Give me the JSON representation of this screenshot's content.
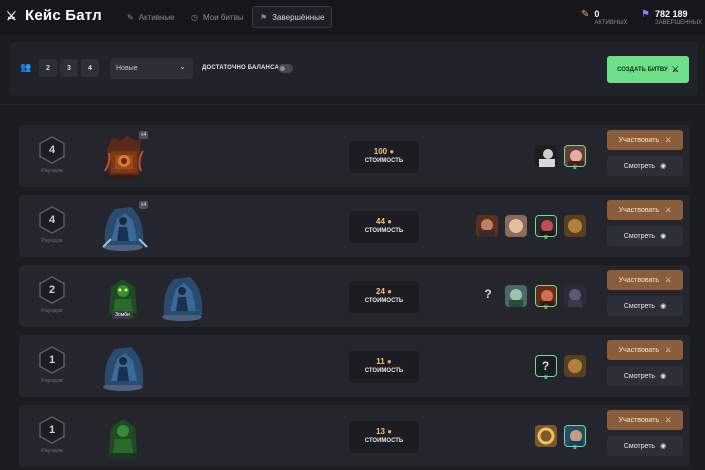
{
  "header": {
    "logo_text": "Кейс Батл",
    "tabs": [
      {
        "label": "Активные",
        "icon": "gamepad-icon"
      },
      {
        "label": "Мои битвы",
        "icon": "clock-icon"
      },
      {
        "label": "Завершённые",
        "icon": "flag-icon"
      }
    ],
    "active_tab": "Завершённые",
    "stats": [
      {
        "value": "0",
        "label": "АКТИВНЫХ",
        "icon": "pencil-icon"
      },
      {
        "value": "782 189",
        "label": "ЗАВЕРШЕННЫХ",
        "icon": "flag-icon"
      }
    ]
  },
  "filters": {
    "player_counts": [
      "2",
      "3",
      "4"
    ],
    "sort_selected": "Новые",
    "balance_label": "ДОСТАТОЧНО БАЛАНСА",
    "balance_toggle": false,
    "create_button": "СОЗДАТЬ БИТВУ"
  },
  "colors": {
    "accent_green": "#6ee08a",
    "join_button": "#8a5e3c",
    "price_orange": "#f6c07a"
  },
  "rows": [
    {
      "rounds": "4",
      "rounds_label": "Раундов",
      "cases": [
        {
          "name": "fire-case",
          "count": "x4"
        }
      ],
      "price": "100",
      "price_label": "СТОИМОСТЬ",
      "join": "Участвовать",
      "watch": "Смотреть"
    },
    {
      "rounds": "4",
      "rounds_label": "Раундов",
      "cases": [
        {
          "name": "ice-case",
          "count": "x4"
        }
      ],
      "price": "44",
      "price_label": "СТОИМОСТЬ",
      "join": "Участвовать",
      "watch": "Смотреть"
    },
    {
      "rounds": "2",
      "rounds_label": "Раундов",
      "cases": [
        {
          "name": "zombie-case",
          "tag": "Зомби"
        },
        {
          "name": "ice-case"
        }
      ],
      "price": "24",
      "price_label": "СТОИМОСТЬ",
      "join": "Участвовать",
      "watch": "Смотреть"
    },
    {
      "rounds": "1",
      "rounds_label": "Раундов",
      "cases": [
        {
          "name": "ice-case"
        }
      ],
      "price": "11",
      "price_label": "СТОИМОСТЬ",
      "join": "Участвовать",
      "watch": "Смотреть"
    },
    {
      "rounds": "1",
      "rounds_label": "Раундов",
      "cases": [
        {
          "name": "zombie-case"
        }
      ],
      "price": "13",
      "price_label": "СТОИМОСТЬ",
      "join": "Участвовать",
      "watch": "Смотреть"
    }
  ]
}
